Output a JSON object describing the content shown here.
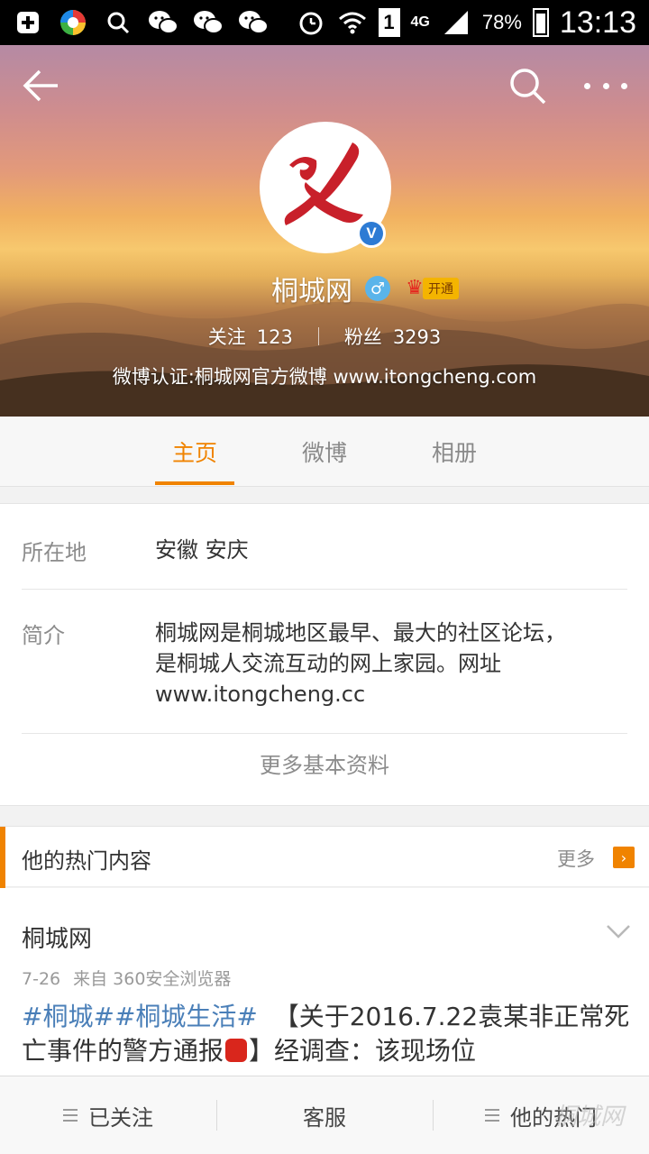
{
  "status_bar": {
    "battery": "78%",
    "network": "4G",
    "sim": "1",
    "time": "13:13"
  },
  "header": {
    "icons": [
      "back-arrow-icon",
      "search-icon",
      "more-icon"
    ],
    "profile_name": "桐城网",
    "vip_label": "开通",
    "verified_mark": "V",
    "gender_symbol": "♂",
    "following_label": "关注",
    "following_count": "123",
    "followers_label": "粉丝",
    "followers_count": "3293",
    "verification": "微博认证:桐城网官方微博 www.itongcheng.com"
  },
  "tabs": [
    {
      "label": "主页",
      "active": true
    },
    {
      "label": "微博",
      "active": false
    },
    {
      "label": "相册",
      "active": false
    }
  ],
  "info": {
    "location_key": "所在地",
    "location_value": "安徽 安庆",
    "bio_key": "简介",
    "bio_value": "桐城网是桐城地区最早、最大的社区论坛，是桐城人交流互动的网上家园。网址www.itongcheng.cc",
    "more_info": "更多基本资料"
  },
  "hot": {
    "title": "他的热门内容",
    "more": "更多",
    "arrow": "›"
  },
  "post": {
    "author": "桐城网",
    "date": "7-26",
    "source": "来自 360安全浏览器",
    "tag1": "#桐城#",
    "tag2": "#桐城生活#",
    "text": "【关于2016.7.22袁某非正常死亡事件的警方通报",
    "text2": "】经调查：该现场位"
  },
  "bottom_bar": {
    "follow": "已关注",
    "service": "客服",
    "hot": "他的热门"
  },
  "watermark": "桐城网",
  "colors": {
    "accent": "#f08300",
    "link": "#4a7fb8",
    "verified": "#2d7bd4"
  }
}
